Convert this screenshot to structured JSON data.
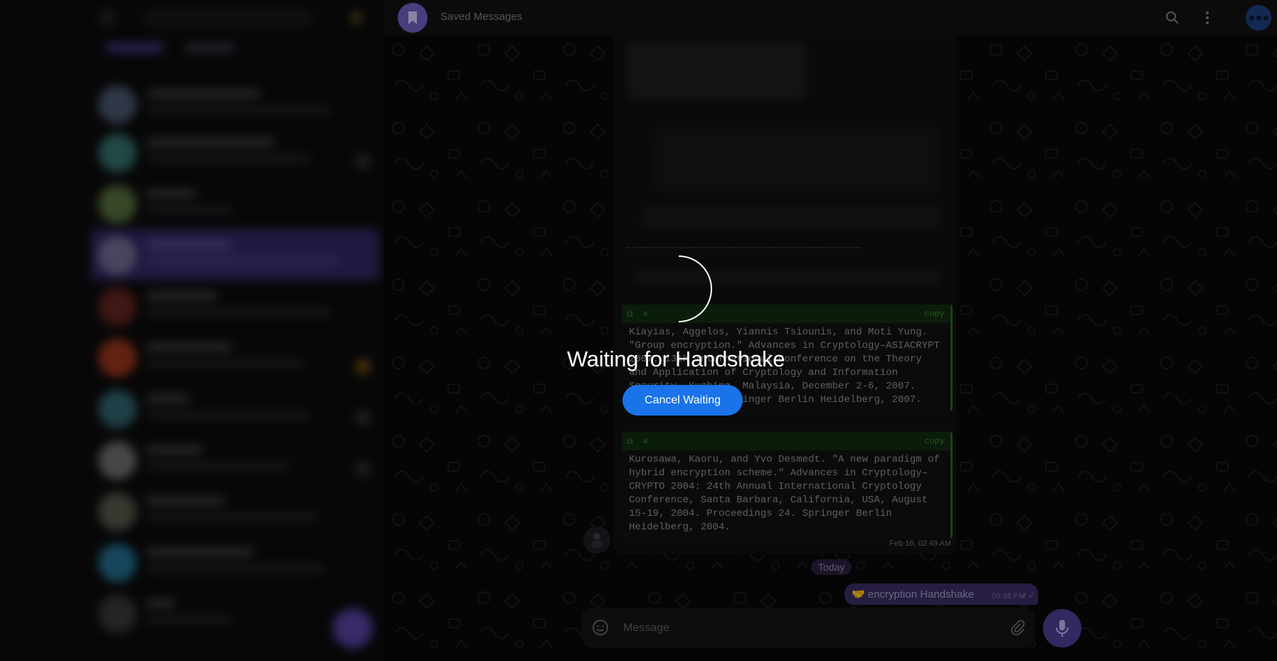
{
  "header": {
    "title": "Saved Messages",
    "icons": [
      "bookmark-icon",
      "search-icon",
      "more-vertical-icon",
      "user-avatar"
    ]
  },
  "messages": {
    "code_blocks": [
      {
        "copy_label": "copy",
        "text": "Kiayias, Aggelos, Yiannis Tsiounis, and Moti Yung. \"Group encryption.\" Advances in Cryptology–ASIACRYPT 2007: 13th International Conference on the Theory and Application of Cryptology and Information Security, Kuching, Malaysia, December 2-6, 2007. Proceedings 13. Springer Berlin Heidelberg, 2007."
      },
      {
        "copy_label": "copy",
        "text": "Kurosawa, Kaoru, and Yvo Desmedt. \"A new paradigm of hybrid encryption scheme.\" Advances in Cryptology–CRYPTO 2004: 24th Annual International Cryptology Conference, Santa Barbara, California, USA, August 15-19, 2004. Proceedings 24. Springer Berlin Heidelberg, 2004."
      }
    ],
    "timestamp": "Feb 16, 02:49 AM",
    "date_separator": "Today",
    "outgoing": {
      "emoji": "🤝",
      "text": "encryption Handshake",
      "time": "09:38 PM",
      "status": "✓✓"
    }
  },
  "composer": {
    "placeholder": "Message"
  },
  "overlay": {
    "title": "Waiting for Handshake",
    "cancel_label": "Cancel Waiting"
  },
  "colors": {
    "accent": "#1a73e8",
    "purple": "#6b5bb8",
    "code_green": "#3d7d2f"
  }
}
